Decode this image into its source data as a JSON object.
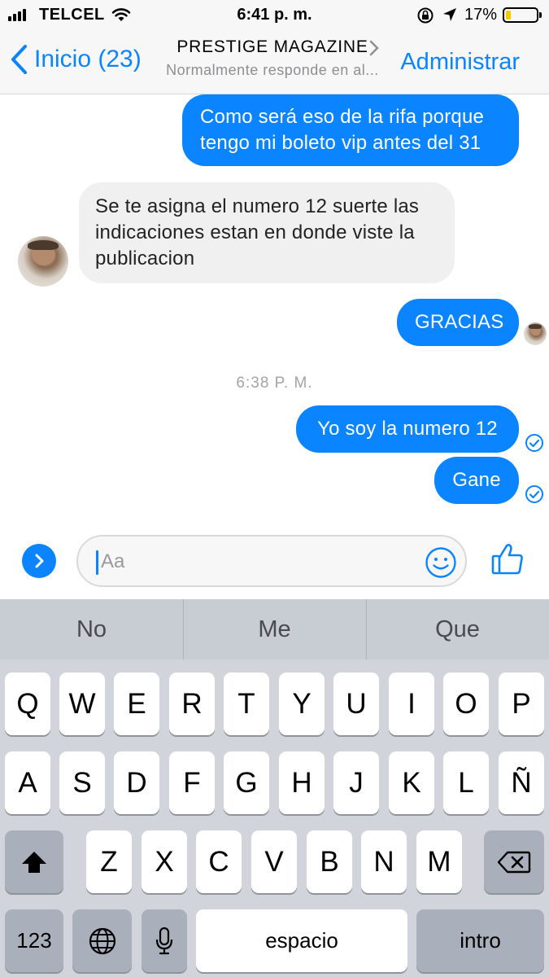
{
  "status_bar": {
    "carrier": "TELCEL",
    "time": "6:41 p. m.",
    "battery_percent_label": "17%",
    "battery_level": 0.17,
    "battery_color": "#f6c900"
  },
  "nav": {
    "back_label": "Inicio (23)",
    "title": "PRESTIGE MAGAZINE",
    "subtitle": "Normalmente responde en al...",
    "action_label": "Administrar",
    "accent_color": "#0a84ff"
  },
  "messages": [
    {
      "direction": "outgoing",
      "text": "Como será eso de la rifa porque tengo mi boleto vip antes del 31"
    },
    {
      "direction": "incoming",
      "text": "Se te asigna el numero 12 suerte las indicaciones estan en donde viste la publicacion"
    },
    {
      "direction": "outgoing",
      "text": "GRACIAS"
    },
    {
      "direction": "outgoing",
      "text": "Yo soy la numero 12"
    },
    {
      "direction": "outgoing",
      "text": "Gane"
    }
  ],
  "timestamp": "6:38 P. M.",
  "composer": {
    "placeholder": "Aa"
  },
  "keyboard": {
    "suggestions": [
      "No",
      "Me",
      "Que"
    ],
    "row1": [
      "Q",
      "W",
      "E",
      "R",
      "T",
      "Y",
      "U",
      "I",
      "O",
      "P"
    ],
    "row2": [
      "A",
      "S",
      "D",
      "F",
      "G",
      "H",
      "J",
      "K",
      "L",
      "Ñ"
    ],
    "row3": [
      "Z",
      "X",
      "C",
      "V",
      "B",
      "N",
      "M"
    ],
    "numbers_label": "123",
    "space_label": "espacio",
    "return_label": "intro"
  },
  "icons": [
    "signal-icon",
    "wifi-icon",
    "orientation-lock-icon",
    "location-icon",
    "battery-icon",
    "back-chevron-icon",
    "title-chevron-icon",
    "read-check-icon",
    "expand-icon",
    "emoji-icon",
    "thumbs-up-icon",
    "shift-icon",
    "backspace-icon",
    "globe-icon",
    "microphone-icon"
  ]
}
